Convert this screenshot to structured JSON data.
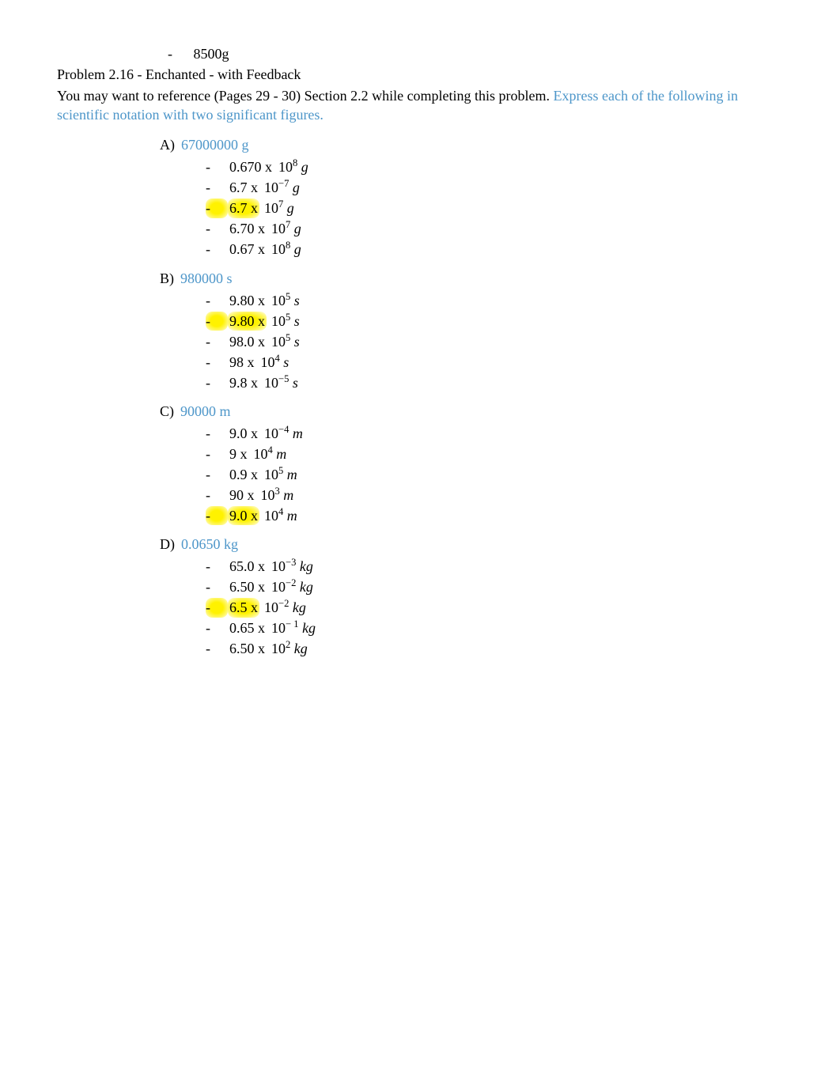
{
  "preItem": "8500g",
  "title": "Problem 2.16 - Enchanted - with Feedback",
  "intro_black": "You may want to reference (Pages 29 - 30) Section 2.2 while completing this problem. ",
  "intro_blue": "Express each of the following in scientific notation with two significant figures.",
  "questions": [
    {
      "letter": "A)",
      "prompt": "67000000 g",
      "options": [
        {
          "coef": "0.670 x ",
          "base": "10",
          "exp": "8",
          "unit": "g",
          "hl": false
        },
        {
          "coef": "6.7 x ",
          "base": "10",
          "exp": "−7",
          "unit": "g",
          "hl": false
        },
        {
          "coef": "6.7 x ",
          "base": "10",
          "exp": "7",
          "unit": "g",
          "hl": true
        },
        {
          "coef": "6.70 x ",
          "base": "10",
          "exp": "7",
          "unit": "g",
          "hl": false
        },
        {
          "coef": "0.67 x ",
          "base": "10",
          "exp": "8",
          "unit": "g",
          "hl": false
        }
      ]
    },
    {
      "letter": "B)",
      "prompt": "980000 s",
      "options": [
        {
          "coef": "9.80 x ",
          "base": "10",
          "exp": "5",
          "unit": "s",
          "hl": false
        },
        {
          "coef": "9.80 x ",
          "base": "10",
          "exp": "5",
          "unit": "s",
          "hl": true
        },
        {
          "coef": "98.0 x ",
          "base": "10",
          "exp": "5",
          "unit": "s",
          "hl": false
        },
        {
          "coef": "98 x ",
          "base": "10",
          "exp": "4",
          "unit": "s",
          "hl": false
        },
        {
          "coef": "9.8 x ",
          "base": "10",
          "exp": "−5",
          "unit": "s",
          "hl": false
        }
      ]
    },
    {
      "letter": "C)",
      "prompt": "90000 m",
      "options": [
        {
          "coef": "9.0 x ",
          "base": "10",
          "exp": "−4",
          "unit": "m",
          "hl": false
        },
        {
          "coef": "9 x ",
          "base": "10",
          "exp": "4",
          "unit": "m",
          "hl": false
        },
        {
          "coef": "0.9 x ",
          "base": "10",
          "exp": "5",
          "unit": "m",
          "hl": false
        },
        {
          "coef": "90 x ",
          "base": "10",
          "exp": "3",
          "unit": "m",
          "hl": false
        },
        {
          "coef": "9.0 x ",
          "base": "10",
          "exp": "4",
          "unit": "m",
          "hl": true
        }
      ]
    },
    {
      "letter": "D)",
      "prompt": "0.0650 kg",
      "options": [
        {
          "coef": "65.0 x ",
          "base": "10",
          "exp": "−3",
          "unit": "kg",
          "hl": false
        },
        {
          "coef": "6.50 x ",
          "base": "10",
          "exp": "−2",
          "unit": "kg",
          "hl": false
        },
        {
          "coef": "6.5 x ",
          "base": "10",
          "exp": "−2",
          "unit": "kg",
          "hl": true
        },
        {
          "coef": "0.65 x ",
          "base": "10",
          "exp": "− 1",
          "unit": "kg",
          "hl": false
        },
        {
          "coef": "6.50 x ",
          "base": "10",
          "exp": "2",
          "unit": "kg",
          "hl": false
        }
      ]
    }
  ]
}
